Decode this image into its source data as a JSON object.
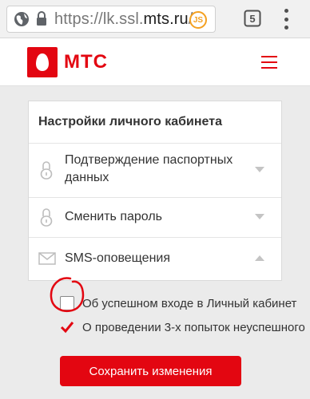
{
  "browser": {
    "url_scheme": "https://",
    "url_host_prefix": "lk.ssl.",
    "url_host": "mts.ru",
    "url_path": "/",
    "extension_label": "JS",
    "tab_count": "5"
  },
  "header": {
    "logo_text": "МТС",
    "brand_color": "#e30611"
  },
  "settings": {
    "title": "Настройки личного кабинета",
    "rows": [
      {
        "label_line1": "Подтверждение паспортных",
        "label_line2": "данных",
        "icon": "lock-icon",
        "expanded": false
      },
      {
        "label_line1": "Сменить пароль",
        "icon": "lock-icon",
        "expanded": false
      },
      {
        "label_line1": "SMS-оповещения",
        "icon": "envelope-icon",
        "expanded": true
      }
    ]
  },
  "sms_options": [
    {
      "label": "Об успешном входе в Личный кабинет",
      "checked": false
    },
    {
      "label": "О проведении 3-х попыток неуспешного",
      "checked": true
    }
  ],
  "save_label": "Сохранить изменения"
}
